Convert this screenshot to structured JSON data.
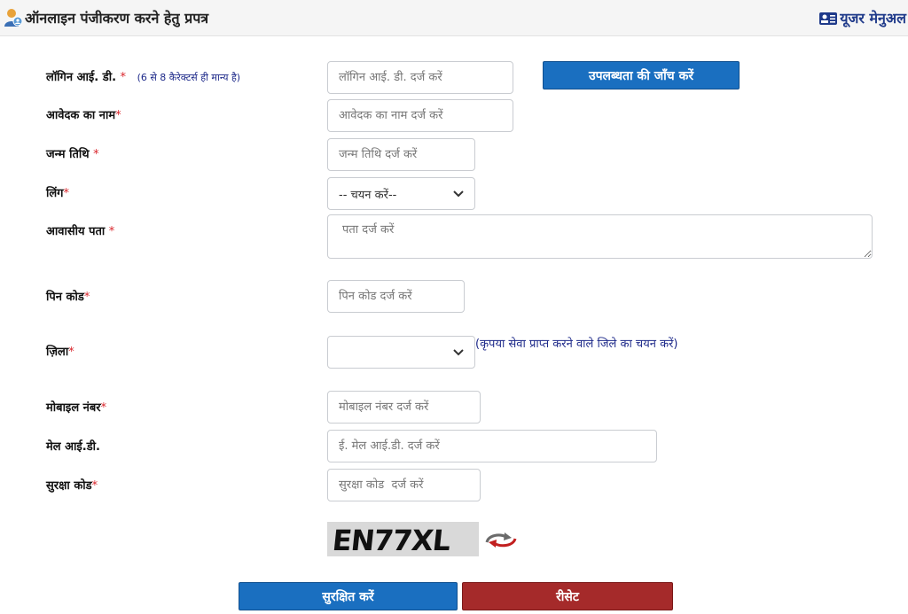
{
  "header": {
    "title": "ऑनलाइन पंजीकरण करने हेतु प्रपत्र",
    "user_manual": "यूजर मेनुअल"
  },
  "form": {
    "login_id": {
      "label": "लॉगिन आई. डी.",
      "required": "*",
      "hint": "(6 से 8 कैरेक्टर्स ही मान्य है)",
      "placeholder": "लॉगिन आई. डी. दर्ज करें",
      "check_button": "उपलब्धता की जाँच करें"
    },
    "applicant_name": {
      "label": "आवेदक का नाम",
      "required": "*",
      "placeholder": "आवेदक का नाम दर्ज करें"
    },
    "dob": {
      "label": "जन्म तिथि",
      "required": "*",
      "placeholder": "जन्म तिथि दर्ज करें"
    },
    "gender": {
      "label": "लिंग",
      "required": "*",
      "selected": "-- चयन करें--"
    },
    "address": {
      "label": "आवासीय पता",
      "required": "*",
      "placeholder": "पता दर्ज करें"
    },
    "pincode": {
      "label": "पिन कोड",
      "required": "*",
      "placeholder": "पिन कोड दर्ज करें"
    },
    "district": {
      "label": "ज़िला",
      "required": "*",
      "selected": "",
      "hint": "(कृपया सेवा प्राप्त करने वाले जिले का चयन करें)"
    },
    "mobile": {
      "label": "मोबाइल नंबर",
      "required": "*",
      "placeholder": "मोबाइल नंबर दर्ज करें"
    },
    "email": {
      "label": "मेल आई.डी.",
      "placeholder": "ई. मेल आई.डी. दर्ज करें"
    },
    "security_code": {
      "label": "सुरक्षा कोड",
      "required": "*",
      "placeholder": "सुरक्षा कोड  दर्ज करें"
    },
    "captcha": {
      "text": "EN77XL"
    }
  },
  "actions": {
    "save": "सुरक्षित करें",
    "reset": "रीसेट"
  },
  "colors": {
    "primary_button": "#1a6fc0",
    "reset_button": "#a52a2a",
    "required_mark": "#d9262c",
    "hint_text": "#1e2a8a"
  },
  "icons": {
    "header": "user-icon",
    "manual": "manual-icon",
    "captcha_refresh": "refresh-icon",
    "select_arrow": "chevron-down-icon"
  }
}
